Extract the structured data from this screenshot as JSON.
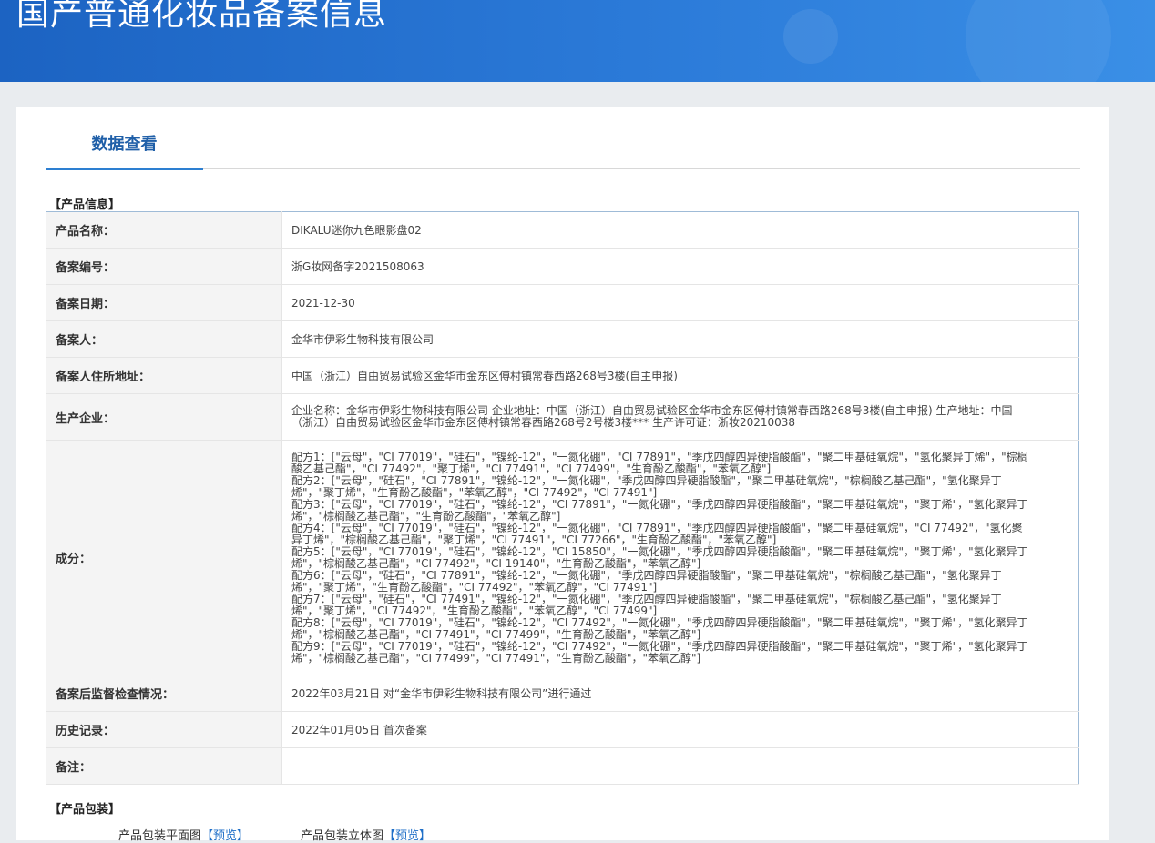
{
  "banner": {
    "title": "国产普通化妆品备案信息"
  },
  "tab": {
    "label": "数据查看"
  },
  "sections": {
    "product_info": "【产品信息】",
    "product_packaging": "【产品包装】"
  },
  "info": {
    "product_name": {
      "label": "产品名称：",
      "value": "DIKALU迷你九色眼影盘02"
    },
    "record_no": {
      "label": "备案编号：",
      "value": "浙G妆网备字2021508063"
    },
    "record_date": {
      "label": "备案日期：",
      "value": "2021-12-30"
    },
    "registrant": {
      "label": "备案人：",
      "value": "金华市伊彩生物科技有限公司"
    },
    "address": {
      "label": "备案人住所地址：",
      "value": "中国（浙江）自由贸易试验区金华市金东区傅村镇常春西路268号3楼(自主申报)"
    },
    "manufacturer": {
      "label": "生产企业：",
      "value": "企业名称：金华市伊彩生物科技有限公司 企业地址：中国（浙江）自由贸易试验区金华市金东区傅村镇常春西路268号3楼(自主申报) 生产地址：中国（浙江）自由贸易试验区金华市金东区傅村镇常春西路268号2号楼3楼*** 生产许可证：浙妆20210038"
    },
    "ingredients": {
      "label": "成分：",
      "formulas": [
        "配方1：[\"云母\"，\"CI 77019\"，\"硅石\"，\"镍纶-12\"，\"一氮化硼\"，\"CI 77891\"，\"季戊四醇四异硬脂酸酯\"，\"聚二甲基硅氧烷\"，\"氢化聚异丁烯\"，\"棕榈酸乙基己酯\"，\"CI 77492\"，\"聚丁烯\"，\"CI 77491\"，\"CI 77499\"，\"生育酚乙酸酯\"，\"苯氧乙醇\"]",
        "配方2：[\"云母\"，\"硅石\"，\"CI 77891\"，\"镍纶-12\"，\"一氮化硼\"，\"季戊四醇四异硬脂酸酯\"，\"聚二甲基硅氧烷\"，\"棕榈酸乙基己酯\"，\"氢化聚异丁烯\"，\"聚丁烯\"，\"生育酚乙酸酯\"，\"苯氧乙醇\"，\"CI 77492\"，\"CI 77491\"]",
        "配方3：[\"云母\"，\"CI 77019\"，\"硅石\"，\"镍纶-12\"，\"CI 77891\"，\"一氮化硼\"，\"季戊四醇四异硬脂酸酯\"，\"聚二甲基硅氧烷\"，\"聚丁烯\"，\"氢化聚异丁烯\"，\"棕榈酸乙基己酯\"，\"生育酚乙酸酯\"，\"苯氧乙醇\"]",
        "配方4：[\"云母\"，\"CI 77019\"，\"硅石\"，\"镍纶-12\"，\"一氮化硼\"，\"CI 77891\"，\"季戊四醇四异硬脂酸酯\"，\"聚二甲基硅氧烷\"，\"CI 77492\"，\"氢化聚异丁烯\"，\"棕榈酸乙基己酯\"，\"聚丁烯\"，\"CI 77491\"，\"CI 77266\"，\"生育酚乙酸酯\"，\"苯氧乙醇\"]",
        "配方5：[\"云母\"，\"CI 77019\"，\"硅石\"，\"镍纶-12\"，\"CI 15850\"，\"一氮化硼\"，\"季戊四醇四异硬脂酸酯\"，\"聚二甲基硅氧烷\"，\"聚丁烯\"，\"氢化聚异丁烯\"，\"棕榈酸乙基己酯\"，\"CI 77492\"，\"CI 19140\"，\"生育酚乙酸酯\"，\"苯氧乙醇\"]",
        "配方6：[\"云母\"，\"硅石\"，\"CI 77891\"，\"镍纶-12\"，\"一氮化硼\"，\"季戊四醇四异硬脂酸酯\"，\"聚二甲基硅氧烷\"，\"棕榈酸乙基己酯\"，\"氢化聚异丁烯\"，\"聚丁烯\"，\"生育酚乙酸酯\"，\"CI 77492\"，\"苯氧乙醇\"，\"CI 77491\"]",
        "配方7：[\"云母\"，\"硅石\"，\"CI 77491\"，\"镍纶-12\"，\"一氮化硼\"，\"季戊四醇四异硬脂酸酯\"，\"聚二甲基硅氧烷\"，\"棕榈酸乙基己酯\"，\"氢化聚异丁烯\"，\"聚丁烯\"，\"CI 77492\"，\"生育酚乙酸酯\"，\"苯氧乙醇\"，\"CI 77499\"]",
        "配方8：[\"云母\"，\"CI 77019\"，\"硅石\"，\"镍纶-12\"，\"CI 77492\"，\"一氮化硼\"，\"季戊四醇四异硬脂酸酯\"，\"聚二甲基硅氧烷\"，\"聚丁烯\"，\"氢化聚异丁烯\"，\"棕榈酸乙基己酯\"，\"CI 77491\"，\"CI 77499\"，\"生育酚乙酸酯\"，\"苯氧乙醇\"]",
        "配方9：[\"云母\"，\"CI 77019\"，\"硅石\"，\"镍纶-12\"，\"CI 77492\"，\"一氮化硼\"，\"季戊四醇四异硬脂酸酯\"，\"聚二甲基硅氧烷\"，\"聚丁烯\"，\"氢化聚异丁烯\"，\"棕榈酸乙基己酯\"，\"CI 77499\"，\"CI 77491\"，\"生育酚乙酸酯\"，\"苯氧乙醇\"]"
      ]
    },
    "inspection": {
      "label": "备案后监督检查情况：",
      "value": "2022年03月21日 对“金华市伊彩生物科技有限公司”进行通过"
    },
    "history": {
      "label": "历史记录：",
      "value": "2022年01月05日 首次备案"
    },
    "remarks": {
      "label": "备注：",
      "value": ""
    }
  },
  "packaging": {
    "flat_label": "产品包装平面图",
    "flat_link": "【预览】",
    "solid_label": "产品包装立体图",
    "solid_link": "【预览】"
  }
}
